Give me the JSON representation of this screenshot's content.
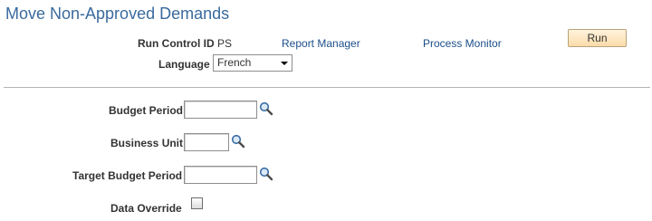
{
  "page": {
    "title": "Move Non-Approved Demands"
  },
  "header": {
    "run_control_label": "Run Control ID",
    "run_control_value": "PS",
    "report_manager_link": "Report Manager",
    "process_monitor_link": "Process Monitor",
    "run_button": "Run",
    "language_label": "Language",
    "language_value": "French"
  },
  "form": {
    "budget_period_label": "Budget Period",
    "budget_period_value": "",
    "business_unit_label": "Business Unit",
    "business_unit_value": "",
    "target_budget_period_label": "Target Budget Period",
    "target_budget_period_value": "",
    "data_override_label": "Data Override",
    "data_override_checked": false
  },
  "colors": {
    "title": "#3a6a9e",
    "link": "#1c4f8a",
    "run_button": "#fbdca9"
  },
  "icons": {
    "lookup": "magnifier-icon",
    "dropdown": "chevron-down-icon",
    "checkbox": "checkbox-icon"
  }
}
